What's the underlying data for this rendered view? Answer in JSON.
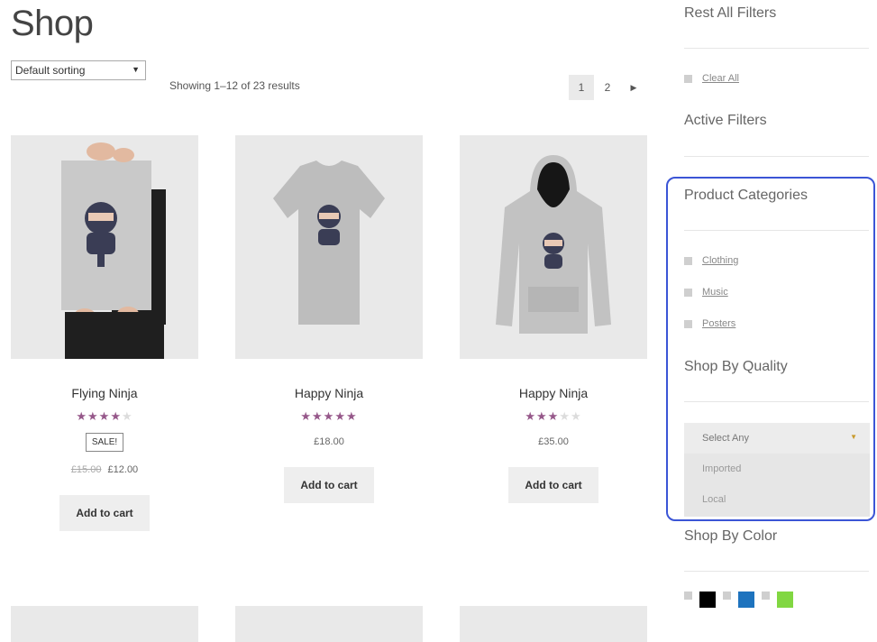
{
  "page": {
    "title": "Shop"
  },
  "toolbar": {
    "sort_value": "Default sorting",
    "results_text": "Showing 1–12 of 23 results",
    "pagination": [
      "1",
      "2"
    ]
  },
  "products": [
    {
      "name": "Flying Ninja",
      "rating": 4,
      "sale_badge": "SALE!",
      "old_price": "£15.00",
      "price": "£12.00",
      "cart_label": "Add to cart",
      "image": "poster-icon"
    },
    {
      "name": "Happy Ninja",
      "rating": 5,
      "price": "£18.00",
      "cart_label": "Add to cart",
      "image": "tshirt-icon"
    },
    {
      "name": "Happy Ninja",
      "rating": 3,
      "price": "£35.00",
      "cart_label": "Add to cart",
      "image": "hoodie-icon"
    }
  ],
  "sidebar": {
    "reset_title": "Rest All Filters",
    "clear_all": "Clear All",
    "active_title": "Active Filters",
    "categories_title": "Product Categories",
    "categories": [
      "Clothing",
      "Music",
      "Posters"
    ],
    "quality_title": "Shop By Quality",
    "quality_select": {
      "selected": "Select Any",
      "options": [
        "Imported",
        "Local"
      ]
    },
    "color_title": "Shop By Color",
    "colors": [
      "#000000",
      "#1e73be",
      "#81d742"
    ]
  },
  "colors": {
    "star": "#96588a",
    "highlight": "#3b55d6"
  }
}
